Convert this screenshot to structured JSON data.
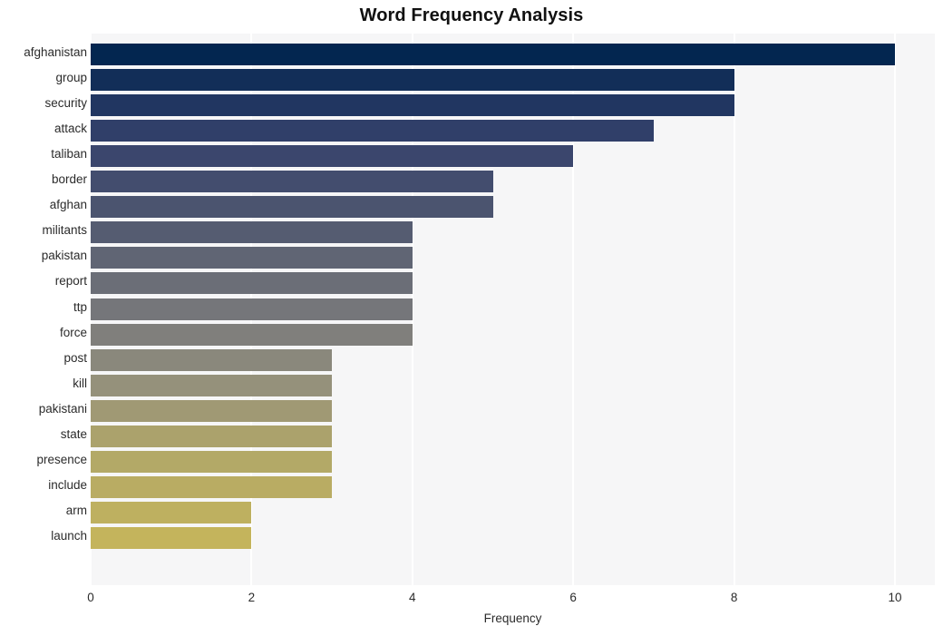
{
  "chart_data": {
    "type": "bar",
    "orientation": "horizontal",
    "title": "Word Frequency Analysis",
    "xlabel": "Frequency",
    "ylabel": "",
    "xlim": [
      0,
      10.5
    ],
    "xticks": [
      0,
      2,
      4,
      6,
      8,
      10
    ],
    "xtick_labels": [
      "0",
      "2",
      "4",
      "6",
      "8",
      "10"
    ],
    "grid": true,
    "grid_axis": "x",
    "legend": "none",
    "categories": [
      "afghanistan",
      "group",
      "security",
      "attack",
      "taliban",
      "border",
      "afghan",
      "militants",
      "pakistan",
      "report",
      "ttp",
      "force",
      "post",
      "kill",
      "pakistani",
      "state",
      "presence",
      "include",
      "arm",
      "launch"
    ],
    "values": [
      10,
      8,
      8,
      7,
      6,
      5,
      5,
      4,
      4,
      4,
      4,
      4,
      3,
      3,
      3,
      3,
      3,
      3,
      2,
      2
    ],
    "bar_colors": [
      "#032650",
      "#364straight",
      "#36426d",
      "#4d566f",
      "#666a75",
      "#7c7c7c",
      "#7e7d79",
      "#94907c",
      "#96927c",
      "#97937c",
      "#989479",
      "#989478",
      "#b1a768",
      "#b2a867",
      "#b3a966",
      "#b4aa65",
      "#b4aa64",
      "#b5ab63",
      "#c3b35d",
      "#c4b45c"
    ],
    "plot_background": "#f6f6f7",
    "gridline_color": "#ffffff",
    "title_color": "#111111",
    "tick_color": "#2b2b2b"
  }
}
